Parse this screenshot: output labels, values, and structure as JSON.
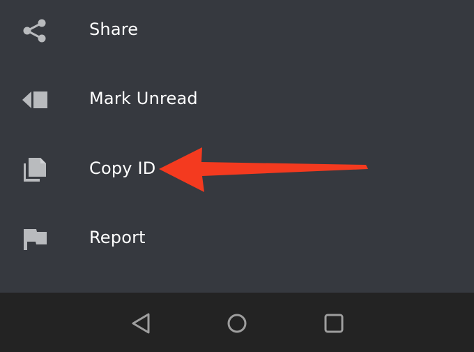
{
  "menu": {
    "items": [
      {
        "label": "Share",
        "icon": "share-icon"
      },
      {
        "label": "Mark Unread",
        "icon": "mark-unread-icon"
      },
      {
        "label": "Copy ID",
        "icon": "copy-icon"
      },
      {
        "label": "Report",
        "icon": "flag-icon"
      }
    ]
  },
  "annotation": {
    "icon": "red-arrow",
    "color": "#f43a1f"
  },
  "navbar": {
    "buttons": [
      {
        "icon": "back-triangle-icon"
      },
      {
        "icon": "home-circle-icon"
      },
      {
        "icon": "recents-square-icon"
      }
    ]
  },
  "colors": {
    "menu_background": "#36393f",
    "navbar_background": "#232323",
    "icon": "#b9bbbe",
    "text": "#ffffff",
    "nav_icon": "#9e9e9e"
  }
}
